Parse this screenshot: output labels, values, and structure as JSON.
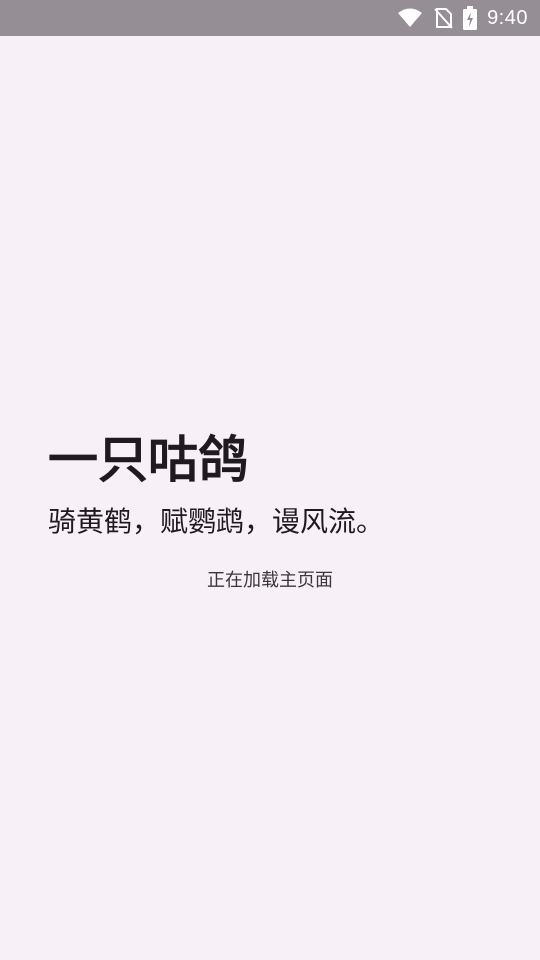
{
  "status_bar": {
    "time": "9:40",
    "icons": [
      "wifi-icon",
      "no-sim-icon",
      "battery-charging-icon"
    ]
  },
  "splash": {
    "title": "一只咕鸽",
    "subtitle": "骑黄鹤，赋鹦鹉，谩风流。",
    "loading_text": "正在加载主页面"
  },
  "colors": {
    "background": "#f8f0f7",
    "status_bar": "#958e95",
    "text_primary": "#1f1a1f",
    "text_secondary": "#3c363c"
  }
}
